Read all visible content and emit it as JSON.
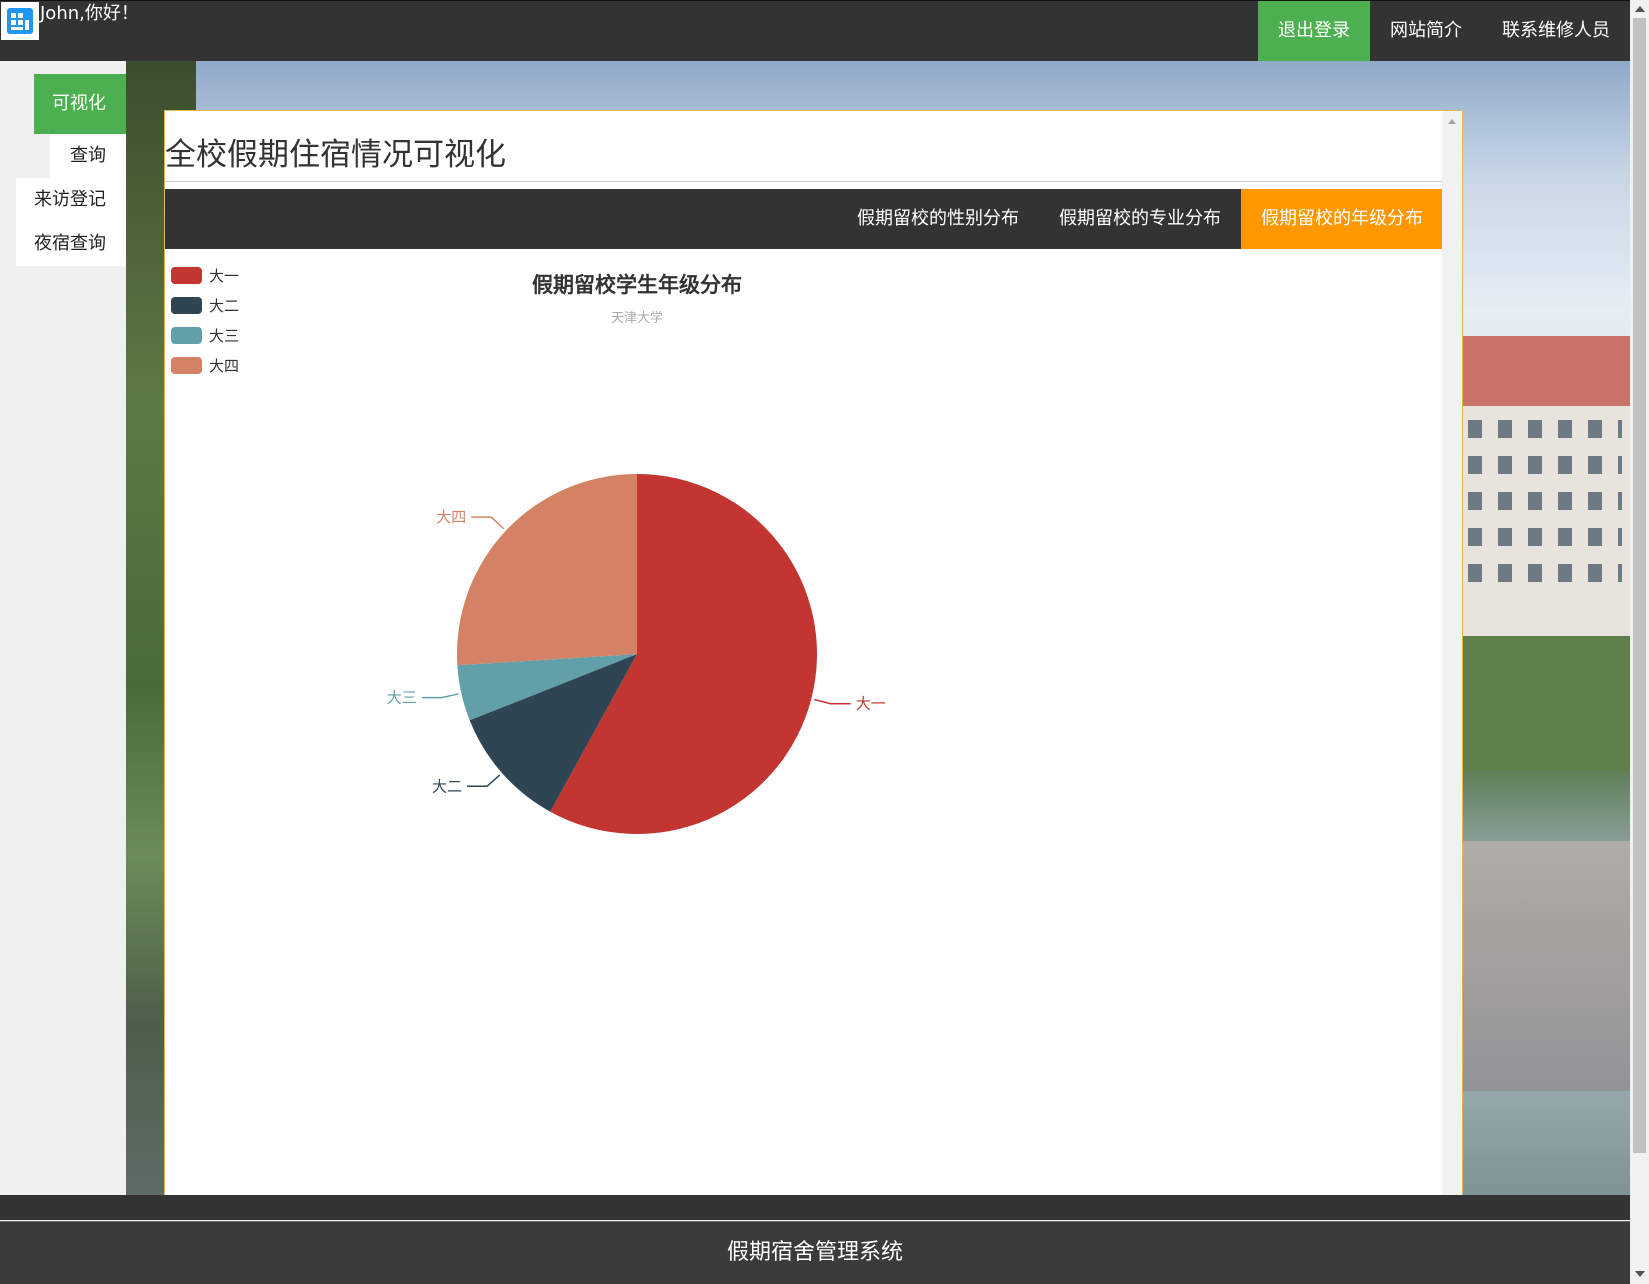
{
  "header": {
    "greeting": "John,你好！",
    "nav": [
      {
        "label": "退出登录",
        "active": true
      },
      {
        "label": "网站简介",
        "active": false
      },
      {
        "label": "联系维修人员",
        "active": false
      }
    ]
  },
  "sidebar": {
    "items": [
      {
        "label": "可视化",
        "active": true
      },
      {
        "label": "查询",
        "active": false
      },
      {
        "label": "来访登记",
        "active": false
      },
      {
        "label": "夜宿查询",
        "active": false
      }
    ]
  },
  "main": {
    "title": "全校假期住宿情况可视化",
    "tabs": [
      {
        "label": "假期留校的性别分布",
        "active": false
      },
      {
        "label": "假期留校的专业分布",
        "active": false
      },
      {
        "label": "假期留校的年级分布",
        "active": true
      }
    ]
  },
  "chart_data": {
    "type": "pie",
    "title": "假期留校学生年级分布",
    "subtitle": "天津大学",
    "legend_position": "top-left",
    "slices": [
      {
        "name": "大一",
        "value": 58,
        "color": "#c23531"
      },
      {
        "name": "大二",
        "value": 11,
        "color": "#2f4554"
      },
      {
        "name": "大三",
        "value": 5,
        "color": "#61a0a8"
      },
      {
        "name": "大四",
        "value": 26,
        "color": "#d48265"
      }
    ]
  },
  "footer": {
    "text": "假期宿舍管理系统"
  },
  "colors": {
    "topbar": "#333333",
    "active_green": "#4caf50",
    "active_orange": "#ff9800"
  }
}
